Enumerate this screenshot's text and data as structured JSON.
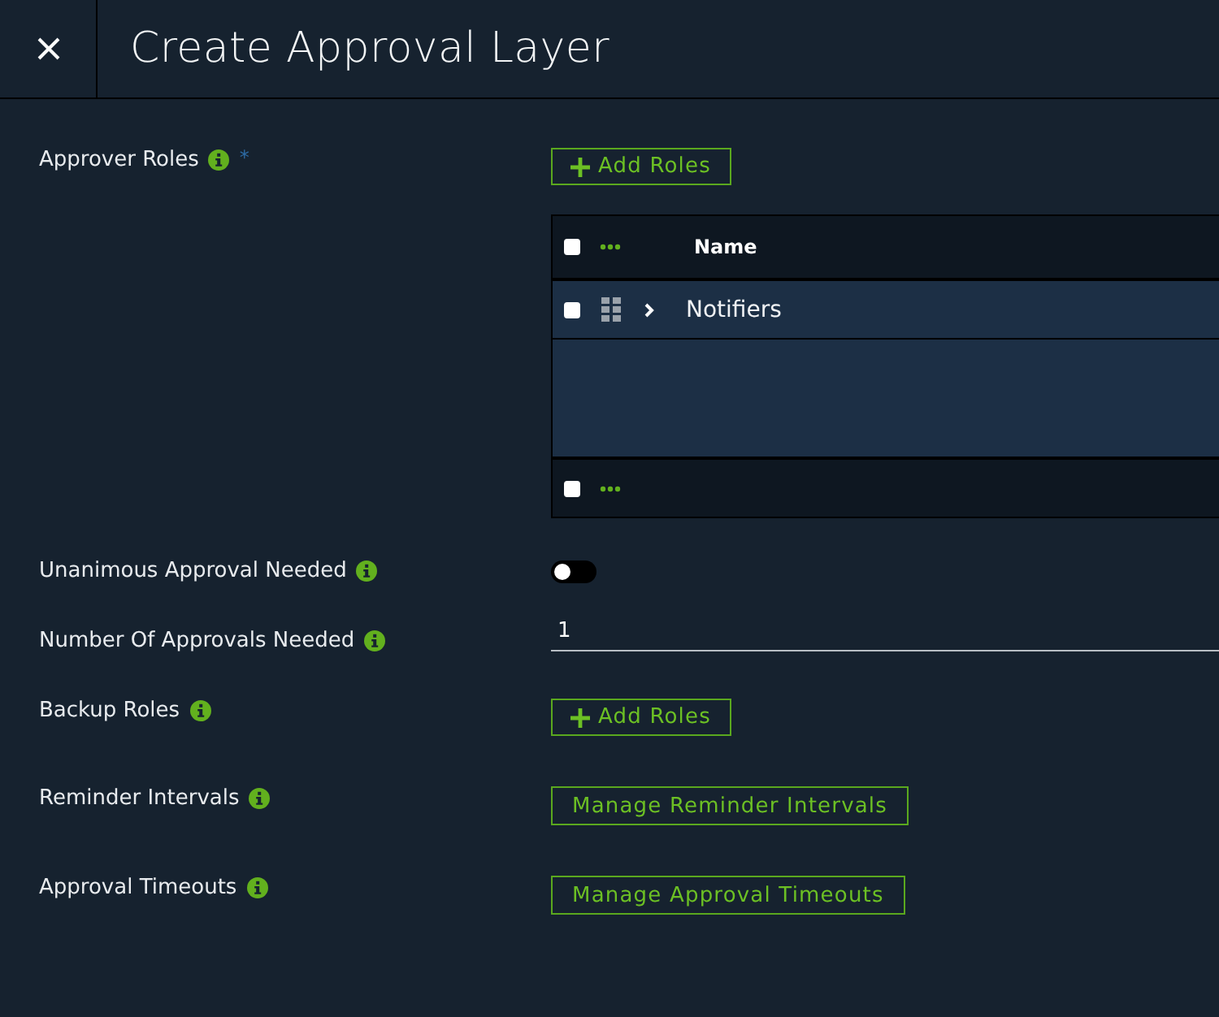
{
  "header": {
    "title": "Create Approval Layer"
  },
  "fields": [
    {
      "kind": "roles",
      "label": "Approver Roles",
      "required_mark": "*",
      "button": "Add Roles",
      "grid": {
        "header_checked": false,
        "column": "Name",
        "rows": [
          {
            "checked": false,
            "name": "Notifiers"
          }
        ],
        "footer_checked": false
      }
    },
    {
      "kind": "toggle",
      "label": "Unanimous Approval Needed",
      "on": false
    },
    {
      "kind": "input",
      "label": "Number Of Approvals Needed",
      "value": "1"
    },
    {
      "kind": "roles",
      "label": "Backup Roles",
      "button": "Add Roles"
    },
    {
      "kind": "button",
      "label": "Reminder Intervals",
      "button": "Manage Reminder Intervals"
    },
    {
      "kind": "button",
      "label": "Approval Timeouts",
      "button": "Manage Approval Timeouts"
    }
  ]
}
